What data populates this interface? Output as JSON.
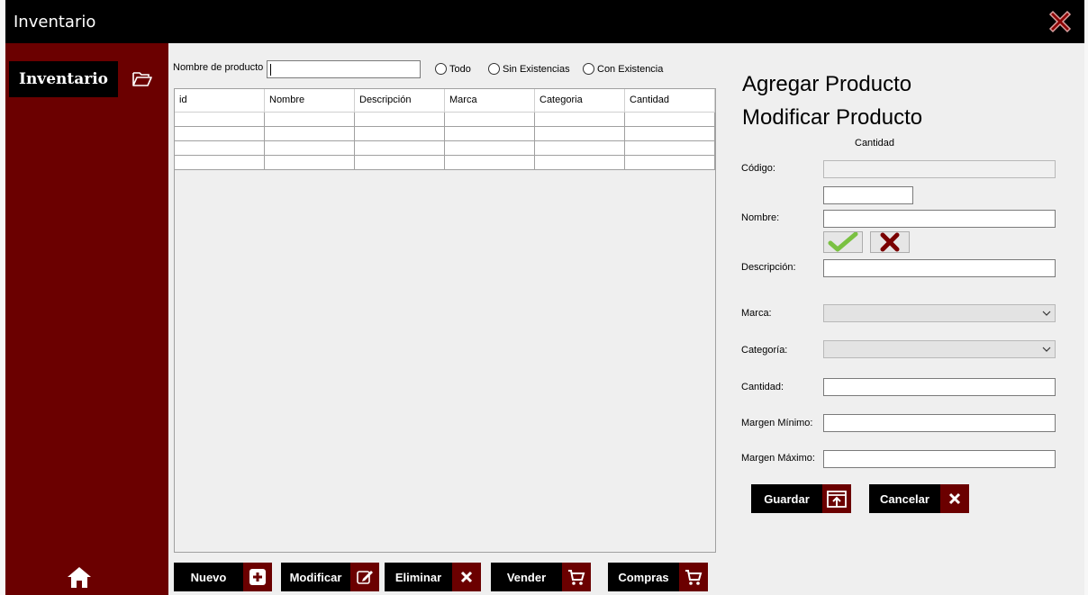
{
  "window": {
    "title": "Inventario"
  },
  "sidebar": {
    "tab_label": "Inventario"
  },
  "search": {
    "label": "Nombre de producto",
    "value": ""
  },
  "filters": [
    {
      "label": "Todo"
    },
    {
      "label": "Sin Existencias"
    },
    {
      "label": "Con Existencia"
    }
  ],
  "table": {
    "columns": [
      "id",
      "Nombre",
      "Descripción",
      "Marca",
      "Categoria",
      "Cantidad"
    ],
    "empty_rows": 4
  },
  "bottom_buttons": [
    {
      "label": "Nuevo",
      "icon": "plus-icon"
    },
    {
      "label": "Modificar",
      "icon": "edit-icon"
    },
    {
      "label": "Eliminar",
      "icon": "close-icon"
    },
    {
      "label": "Vender",
      "icon": "cart-icon"
    },
    {
      "label": "Compras",
      "icon": "cart-icon"
    }
  ],
  "form": {
    "title_add": "Agregar Producto",
    "title_modify": "Modificar Producto",
    "quantity_caption": "Cantidad",
    "labels": {
      "codigo": "Código:",
      "nombre": "Nombre:",
      "descripcion": "Descripción:",
      "marca": "Marca:",
      "categoria": "Categoría:",
      "cantidad": "Cantidad:",
      "margen_min": "Margen Mínimo:",
      "margen_max": "Margen Máximo:"
    },
    "save_label": "Guardar",
    "cancel_label": "Cancelar"
  },
  "colors": {
    "accent": "#6b0000",
    "titlebar": "#000000",
    "panel": "#efefef"
  }
}
